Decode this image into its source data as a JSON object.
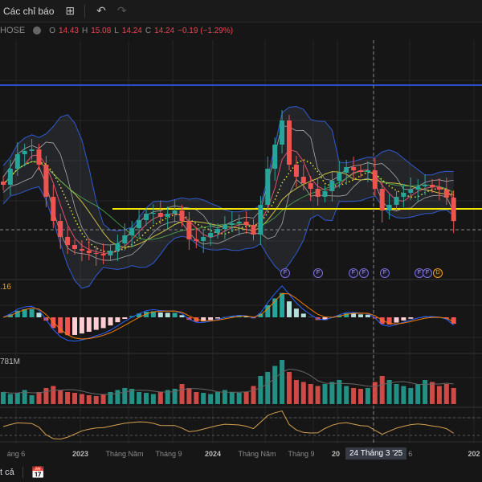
{
  "toolbar": {
    "indicators_label": "Các chỉ báo",
    "layout_icon": "grid-icon",
    "undo_icon": "undo-icon",
    "redo_icon": "redo-icon"
  },
  "legend": {
    "symbol": "HOSE",
    "open_key": "O",
    "open": "14.43",
    "high_key": "H",
    "high": "15.08",
    "low_key": "L",
    "low": "14.24",
    "close_key": "C",
    "close": "14.24",
    "change": "−0.19 (−1.29%)"
  },
  "macd_label": ".16",
  "volume_label": "781M",
  "events": [
    "F",
    "F",
    "F",
    "F",
    "F",
    "F",
    "F",
    "D"
  ],
  "crosshair_label": "24 Tháng 3 '25",
  "bottom": {
    "range_label": "t cả",
    "calendar_icon": "calendar-icon"
  },
  "colors": {
    "up": "#26a69a",
    "down": "#ef5350",
    "bb": "#2f5bd3",
    "blue_level": "#2a4fd0",
    "yellow_level": "#f2e600"
  },
  "chart_data": {
    "type": "candlestick",
    "x_labels": [
      "áng 6",
      "2023",
      "Tháng Năm",
      "Tháng 9",
      "2024",
      "Tháng Năm",
      "Tháng 9",
      "20",
      "g 6",
      "202"
    ],
    "closes": [
      16.5,
      17.5,
      18.4,
      18.6,
      18.7,
      17.75,
      15.75,
      14.25,
      13.25,
      12.75,
      12.5,
      12.4,
      12.25,
      12.2,
      12.1,
      12.4,
      12.85,
      13.35,
      13.8,
      14.3,
      14.7,
      14.75,
      14.5,
      14.7,
      14.9,
      14.25,
      13.1,
      13.0,
      13.25,
      13.5,
      13.75,
      14.0,
      14.1,
      14.2,
      14.0,
      13.4,
      15.25,
      17.5,
      19.0,
      20.5,
      17.75,
      17.0,
      16.6,
      16.25,
      15.75,
      16.1,
      16.75,
      17.25,
      17.6,
      17.4,
      17.3,
      17.4,
      16.25,
      14.9,
      15.25,
      15.75,
      16.0,
      16.2,
      16.4,
      16.5,
      16.35,
      16.2,
      15.7,
      14.24
    ],
    "volumes_m": [
      30,
      25,
      28,
      35,
      22,
      30,
      40,
      45,
      35,
      30,
      28,
      25,
      22,
      20,
      25,
      30,
      35,
      40,
      38,
      30,
      28,
      25,
      30,
      35,
      38,
      50,
      40,
      30,
      28,
      25,
      30,
      35,
      30,
      28,
      30,
      45,
      70,
      80,
      95,
      110,
      80,
      60,
      55,
      50,
      45,
      50,
      55,
      60,
      45,
      40,
      38,
      40,
      55,
      70,
      60,
      50,
      45,
      40,
      50,
      60,
      55,
      45,
      50,
      40
    ],
    "levels": {
      "blue": 22.7,
      "yellow": 15.0
    },
    "y_range": [
      10.5,
      24
    ]
  }
}
